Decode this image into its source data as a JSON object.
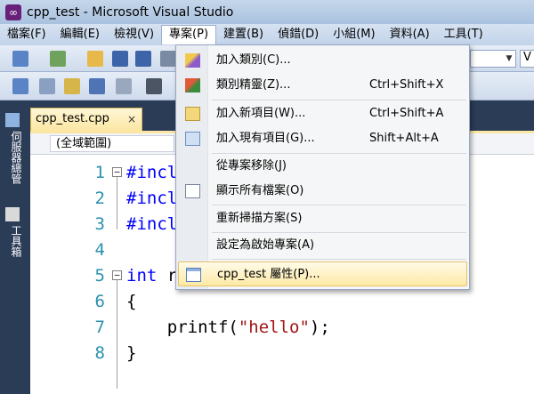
{
  "window": {
    "title": "cpp_test - Microsoft Visual Studio"
  },
  "menubar": {
    "items": [
      {
        "label": "檔案(F)"
      },
      {
        "label": "編輯(E)"
      },
      {
        "label": "檢視(V)"
      },
      {
        "label": "專案(P)"
      },
      {
        "label": "建置(B)"
      },
      {
        "label": "偵錯(D)"
      },
      {
        "label": "小組(M)"
      },
      {
        "label": "資料(A)"
      },
      {
        "label": "工具(T)"
      }
    ]
  },
  "toolbar": {
    "config_combo_value": "",
    "platform_combo_value": "V"
  },
  "sidebar": {
    "tab1": "伺服器總管",
    "tab2": "工具箱"
  },
  "editor": {
    "tab_title": "cpp_test.cpp",
    "tab_close": "×",
    "scope": "(全域範圍)",
    "lines": [
      {
        "num": "1",
        "kw": "#incl",
        "rest": "",
        "fold": "−"
      },
      {
        "num": "2",
        "kw": "#incl",
        "rest": ""
      },
      {
        "num": "3",
        "kw": "#incl",
        "rest": ""
      },
      {
        "num": "4",
        "kw": "",
        "rest": ""
      },
      {
        "num": "5",
        "kw": "int",
        "rest": " r",
        "fold": "−"
      },
      {
        "num": "6",
        "kw": "",
        "rest": "{"
      },
      {
        "num": "7",
        "pre": "    printf(",
        "str": "\"hello\"",
        "post": ");"
      },
      {
        "num": "8",
        "kw": "",
        "rest": "}"
      }
    ]
  },
  "project_menu": {
    "items": [
      {
        "label": "加入類別(C)...",
        "shortcut": "",
        "icon": "add-class-icon"
      },
      {
        "label": "類別精靈(Z)...",
        "shortcut": "Ctrl+Shift+X",
        "icon": "class-wizard-icon"
      },
      {
        "label": "加入新項目(W)...",
        "shortcut": "Ctrl+Shift+A",
        "icon": "add-new-item-icon"
      },
      {
        "label": "加入現有項目(G)...",
        "shortcut": "Shift+Alt+A",
        "icon": "add-existing-item-icon"
      },
      {
        "label": "從專案移除(J)",
        "shortcut": ""
      },
      {
        "label": "顯示所有檔案(O)",
        "shortcut": "",
        "icon": "show-all-files-icon"
      },
      {
        "label": "重新掃描方案(S)",
        "shortcut": ""
      },
      {
        "label": "設定為啟始專案(A)",
        "shortcut": ""
      },
      {
        "label": "cpp_test 屬性(P)...",
        "shortcut": "",
        "icon": "properties-icon"
      }
    ]
  }
}
